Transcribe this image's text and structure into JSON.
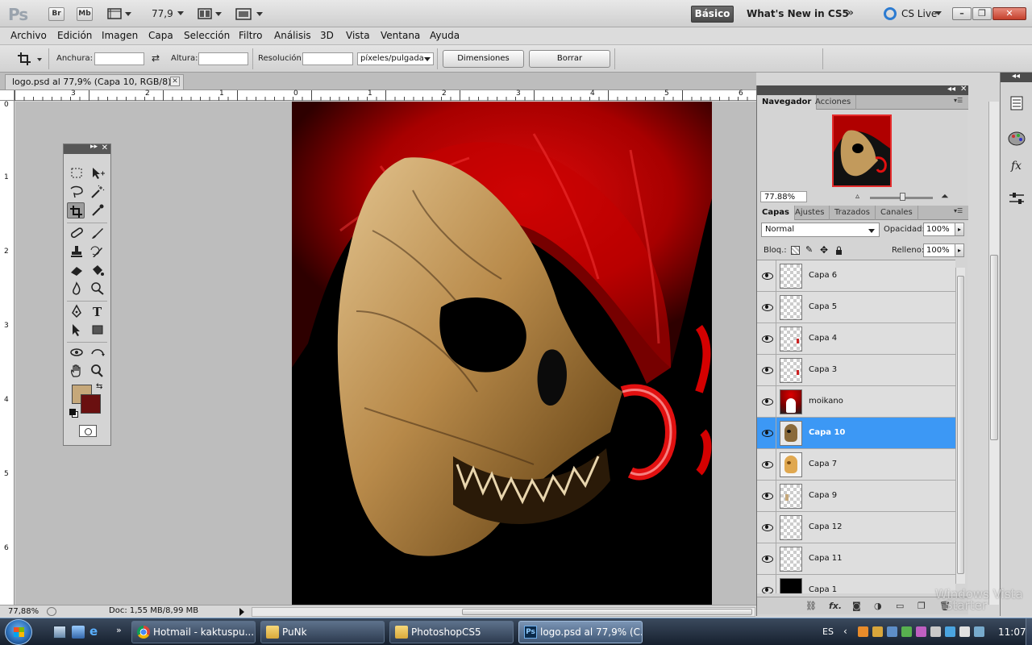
{
  "app": {
    "logo": "Ps",
    "bridge": "Br",
    "minibridge": "Mb",
    "zoom_value": "77,9",
    "workspace": "Básico",
    "whats_new": "What's New in CS5",
    "more": "»",
    "cs_live": "CS Live",
    "win_min": "–",
    "win_max": "❐",
    "win_close": "✕"
  },
  "menu": [
    "Archivo",
    "Edición",
    "Imagen",
    "Capa",
    "Selección",
    "Filtro",
    "Análisis",
    "3D",
    "Vista",
    "Ventana",
    "Ayuda"
  ],
  "options": {
    "width_label": "Anchura:",
    "height_label": "Altura:",
    "resolution_label": "Resolución:",
    "units": "píxeles/pulgada",
    "front_image_button": "Dimensiones",
    "clear_button": "Borrar"
  },
  "document": {
    "tab_title": "logo.psd al 77,9% (Capa 10, RGB/8) *",
    "ruler_h": [
      "3",
      "2",
      "1",
      "0",
      "1",
      "2",
      "3",
      "4",
      "5",
      "6"
    ],
    "ruler_v": [
      "0",
      "1",
      "2",
      "3",
      "4",
      "5",
      "6"
    ],
    "status_zoom": "77,88%",
    "status_info": "Doc: 1,55 MB/8,99 MB"
  },
  "navigator": {
    "tabs": [
      "Navegador",
      "Acciones"
    ],
    "zoom": "77.88%",
    "zoom_fraction": 0.52
  },
  "layers_panel": {
    "tabs": [
      "Capas",
      "Ajustes",
      "Trazados",
      "Canales"
    ],
    "blend_mode": "Normal",
    "opacity_label": "Opacidad:",
    "opacity_value": "100%",
    "lock_label": "Bloq.:",
    "fill_label": "Relleno:",
    "fill_value": "100%",
    "layers": [
      {
        "name": "Capa 6",
        "selected": false,
        "thumb": "transparent"
      },
      {
        "name": "Capa 5",
        "selected": false,
        "thumb": "transparent"
      },
      {
        "name": "Capa 4",
        "selected": false,
        "thumb": "red-mark"
      },
      {
        "name": "Capa 3",
        "selected": false,
        "thumb": "red-mark"
      },
      {
        "name": "moikano",
        "selected": false,
        "thumb": "mohawk"
      },
      {
        "name": "Capa 10",
        "selected": true,
        "thumb": "skull-dark"
      },
      {
        "name": "Capa 7",
        "selected": false,
        "thumb": "skull-light"
      },
      {
        "name": "Capa 9",
        "selected": false,
        "thumb": "beige-mark"
      },
      {
        "name": "Capa 12",
        "selected": false,
        "thumb": "transparent"
      },
      {
        "name": "Capa 11",
        "selected": false,
        "thumb": "transparent"
      },
      {
        "name": "Capa 1",
        "selected": false,
        "thumb": "black"
      }
    ],
    "footer_icons": [
      "link-icon",
      "fx-icon",
      "mask-icon",
      "adjustment-icon",
      "folder-icon",
      "new-layer-icon",
      "trash-icon"
    ]
  },
  "colors": {
    "foreground": "#c6a87a",
    "background": "#6a1010",
    "selection": "#3c98f5"
  },
  "taskbar": {
    "items": [
      {
        "label": "Hotmail - kaktuspu...",
        "icon": "chrome-icon",
        "active": false
      },
      {
        "label": "PuNk",
        "icon": "folder-icon",
        "active": false
      },
      {
        "label": "PhotoshopCS5",
        "icon": "folder-icon",
        "active": false
      },
      {
        "label": "logo.psd al 77,9% (C...",
        "icon": "photoshop-icon",
        "active": true
      }
    ],
    "language": "ES",
    "time": "11:07",
    "watermark_line1": "Windows Vista",
    "watermark_line2": "Starter"
  }
}
